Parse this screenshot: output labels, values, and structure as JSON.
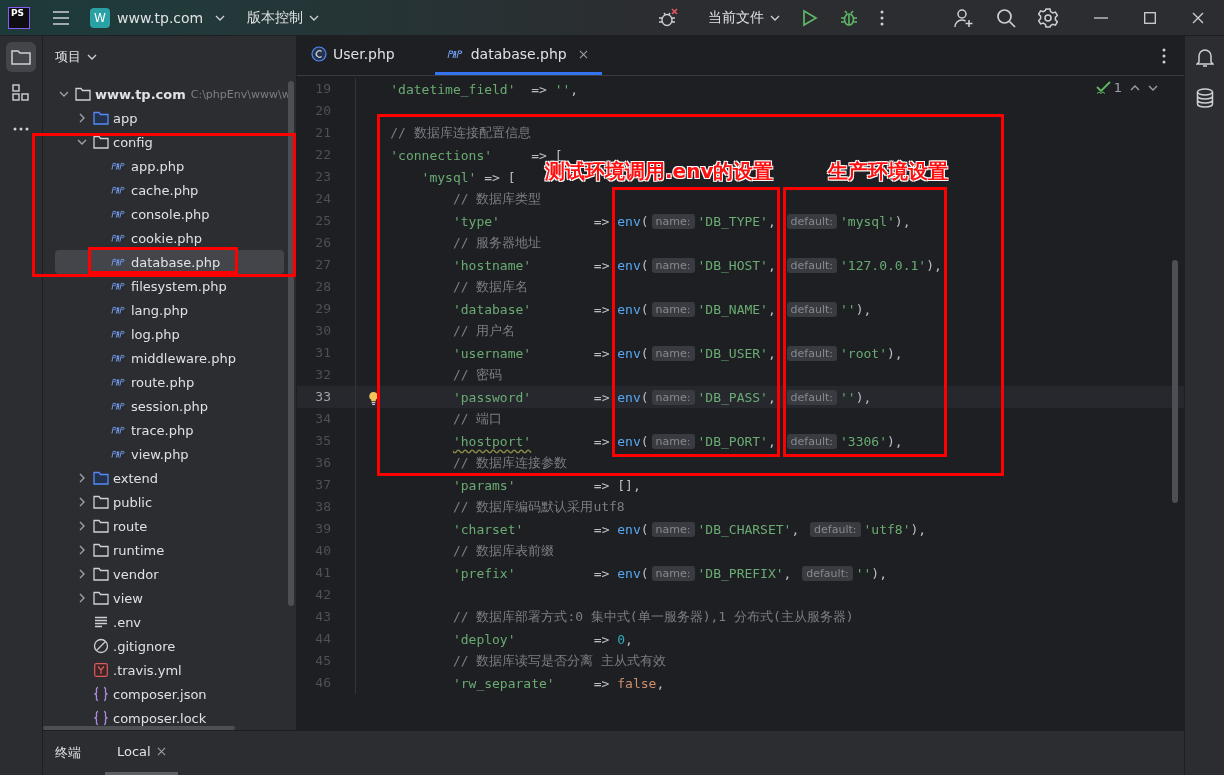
{
  "titlebar": {
    "logo": "PS",
    "project_badge": "W",
    "project": "www.tp.com",
    "vcs": "版本控制",
    "run_config": "当前文件"
  },
  "left_toolbar": [
    {
      "kind": "project",
      "selected": true
    },
    {
      "kind": "structure",
      "selected": false
    },
    {
      "kind": "more",
      "selected": false
    }
  ],
  "project_panel": {
    "title": "项目",
    "tree": [
      {
        "name": "www.tp.com",
        "path": "C:\\phpEnv\\www\\w",
        "kind": "folder",
        "expanded": true,
        "selected": false,
        "children": [
          {
            "name": "app",
            "kind": "source-folder",
            "expanded": false,
            "selected": false
          },
          {
            "name": "config",
            "kind": "folder",
            "expanded": true,
            "selected": false,
            "children": [
              {
                "name": "app.php",
                "kind": "php",
                "selected": false
              },
              {
                "name": "cache.php",
                "kind": "php",
                "selected": false
              },
              {
                "name": "console.php",
                "kind": "php",
                "selected": false
              },
              {
                "name": "cookie.php",
                "kind": "php",
                "selected": false
              },
              {
                "name": "database.php",
                "kind": "php",
                "selected": true
              },
              {
                "name": "filesystem.php",
                "kind": "php",
                "selected": false
              },
              {
                "name": "lang.php",
                "kind": "php",
                "selected": false
              },
              {
                "name": "log.php",
                "kind": "php",
                "selected": false
              },
              {
                "name": "middleware.php",
                "kind": "php",
                "selected": false
              },
              {
                "name": "route.php",
                "kind": "php",
                "selected": false
              },
              {
                "name": "session.php",
                "kind": "php",
                "selected": false
              },
              {
                "name": "trace.php",
                "kind": "php",
                "selected": false
              },
              {
                "name": "view.php",
                "kind": "php",
                "selected": false
              }
            ]
          },
          {
            "name": "extend",
            "kind": "source-folder",
            "expanded": false,
            "selected": false
          },
          {
            "name": "public",
            "kind": "folder",
            "expanded": false,
            "selected": false
          },
          {
            "name": "route",
            "kind": "folder",
            "expanded": false,
            "selected": false
          },
          {
            "name": "runtime",
            "kind": "folder",
            "expanded": false,
            "selected": false
          },
          {
            "name": "vendor",
            "kind": "folder",
            "expanded": false,
            "selected": false
          },
          {
            "name": "view",
            "kind": "folder",
            "expanded": false,
            "selected": false
          },
          {
            "name": ".env",
            "kind": "text",
            "selected": false
          },
          {
            "name": ".gitignore",
            "kind": "ignore",
            "selected": false
          },
          {
            "name": ".travis.yml",
            "kind": "yml",
            "selected": false
          },
          {
            "name": "composer.json",
            "kind": "json",
            "selected": false
          },
          {
            "name": "composer.lock",
            "kind": "json",
            "selected": false
          }
        ]
      }
    ]
  },
  "editor": {
    "tabs": [
      {
        "label": "User.php",
        "kind": "class",
        "selected": false,
        "closable": false
      },
      {
        "label": "database.php",
        "kind": "php",
        "selected": true,
        "closable": true
      }
    ],
    "inspection": {
      "count": "1"
    },
    "lines": [
      {
        "no": "19",
        "current": false,
        "tokens": [
          {
            "kind": "str",
            "text": "'datetime_field'"
          },
          {
            "kind": "txt",
            "text": "  => "
          },
          {
            "kind": "str",
            "text": "''"
          },
          {
            "kind": "txt",
            "text": ","
          }
        ]
      },
      {
        "no": "20",
        "current": false
      },
      {
        "no": "21",
        "current": false,
        "tokens": [
          {
            "kind": "cmt",
            "text": "// 数据库连接配置信息"
          }
        ]
      },
      {
        "no": "22",
        "current": false,
        "tokens": [
          {
            "kind": "str",
            "text": "'connections'"
          },
          {
            "kind": "txt",
            "text": "     => ["
          }
        ],
        "children": [
          {
            "no": "23",
            "current": false,
            "tokens": [
              {
                "kind": "str",
                "text": "'mysql'"
              },
              {
                "kind": "txt",
                "text": " => ["
              }
            ],
            "children": [
              {
                "no": "24",
                "current": false,
                "tokens": [
                  {
                    "kind": "cmt",
                    "text": "// 数据库类型"
                  }
                ]
              },
              {
                "no": "25",
                "current": false,
                "tokens": [
                  {
                    "kind": "str",
                    "text": "'type'"
                  },
                  {
                    "kind": "txt",
                    "text": "            => "
                  },
                  {
                    "kind": "fn",
                    "text": "env"
                  },
                  {
                    "kind": "txt",
                    "text": "("
                  },
                  {
                    "kind": "hint",
                    "text": "name:"
                  },
                  {
                    "kind": "str",
                    "text": "'DB_TYPE'"
                  },
                  {
                    "kind": "txt",
                    "text": ", "
                  },
                  {
                    "kind": "hint",
                    "text": "default:"
                  },
                  {
                    "kind": "str",
                    "text": "'mysql'"
                  },
                  {
                    "kind": "txt",
                    "text": "),"
                  }
                ]
              },
              {
                "no": "26",
                "current": false,
                "tokens": [
                  {
                    "kind": "cmt",
                    "text": "// 服务器地址"
                  }
                ]
              },
              {
                "no": "27",
                "current": false,
                "tokens": [
                  {
                    "kind": "str",
                    "text": "'hostname'"
                  },
                  {
                    "kind": "txt",
                    "text": "        => "
                  },
                  {
                    "kind": "fn",
                    "text": "env"
                  },
                  {
                    "kind": "txt",
                    "text": "("
                  },
                  {
                    "kind": "hint",
                    "text": "name:"
                  },
                  {
                    "kind": "str",
                    "text": "'DB_HOST'"
                  },
                  {
                    "kind": "txt",
                    "text": ", "
                  },
                  {
                    "kind": "hint",
                    "text": "default:"
                  },
                  {
                    "kind": "str",
                    "text": "'127.0.0.1'"
                  },
                  {
                    "kind": "txt",
                    "text": "),"
                  }
                ]
              },
              {
                "no": "28",
                "current": false,
                "tokens": [
                  {
                    "kind": "cmt",
                    "text": "// 数据库名"
                  }
                ]
              },
              {
                "no": "29",
                "current": false,
                "tokens": [
                  {
                    "kind": "str",
                    "text": "'database'"
                  },
                  {
                    "kind": "txt",
                    "text": "        => "
                  },
                  {
                    "kind": "fn",
                    "text": "env"
                  },
                  {
                    "kind": "txt",
                    "text": "("
                  },
                  {
                    "kind": "hint",
                    "text": "name:"
                  },
                  {
                    "kind": "str",
                    "text": "'DB_NAME'"
                  },
                  {
                    "kind": "txt",
                    "text": ", "
                  },
                  {
                    "kind": "hint",
                    "text": "default:"
                  },
                  {
                    "kind": "str",
                    "text": "''"
                  },
                  {
                    "kind": "txt",
                    "text": "),"
                  }
                ]
              },
              {
                "no": "30",
                "current": false,
                "tokens": [
                  {
                    "kind": "cmt",
                    "text": "// 用户名"
                  }
                ]
              },
              {
                "no": "31",
                "current": false,
                "tokens": [
                  {
                    "kind": "str",
                    "text": "'username'"
                  },
                  {
                    "kind": "txt",
                    "text": "        => "
                  },
                  {
                    "kind": "fn",
                    "text": "env"
                  },
                  {
                    "kind": "txt",
                    "text": "("
                  },
                  {
                    "kind": "hint",
                    "text": "name:"
                  },
                  {
                    "kind": "str",
                    "text": "'DB_USER'"
                  },
                  {
                    "kind": "txt",
                    "text": ", "
                  },
                  {
                    "kind": "hint",
                    "text": "default:"
                  },
                  {
                    "kind": "str",
                    "text": "'root'"
                  },
                  {
                    "kind": "txt",
                    "text": "),"
                  }
                ]
              },
              {
                "no": "32",
                "current": false,
                "tokens": [
                  {
                    "kind": "cmt",
                    "text": "// 密码"
                  }
                ]
              },
              {
                "no": "33",
                "current": true,
                "tokens": [
                  {
                    "kind": "str",
                    "text": "'password'"
                  },
                  {
                    "kind": "txt",
                    "text": "        => "
                  },
                  {
                    "kind": "fn",
                    "text": "env"
                  },
                  {
                    "kind": "txt",
                    "text": "("
                  },
                  {
                    "kind": "hint",
                    "text": "name:"
                  },
                  {
                    "kind": "str",
                    "text": "'DB_PASS'"
                  },
                  {
                    "kind": "txt",
                    "text": ", "
                  },
                  {
                    "kind": "hint",
                    "text": "default:"
                  },
                  {
                    "kind": "str",
                    "text": "''"
                  },
                  {
                    "kind": "txt",
                    "text": "),"
                  }
                ]
              },
              {
                "no": "34",
                "current": false,
                "tokens": [
                  {
                    "kind": "cmt",
                    "text": "// 端口"
                  }
                ]
              },
              {
                "no": "35",
                "current": false,
                "tokens": [
                  {
                    "kind": "typo",
                    "text": "'hostport'"
                  },
                  {
                    "kind": "txt",
                    "text": "        => "
                  },
                  {
                    "kind": "fn",
                    "text": "env"
                  },
                  {
                    "kind": "txt",
                    "text": "("
                  },
                  {
                    "kind": "hint",
                    "text": "name:"
                  },
                  {
                    "kind": "str",
                    "text": "'DB_PORT'"
                  },
                  {
                    "kind": "txt",
                    "text": ", "
                  },
                  {
                    "kind": "hint",
                    "text": "default:"
                  },
                  {
                    "kind": "str",
                    "text": "'3306'"
                  },
                  {
                    "kind": "txt",
                    "text": "),"
                  }
                ]
              },
              {
                "no": "36",
                "current": false,
                "tokens": [
                  {
                    "kind": "cmt",
                    "text": "// 数据库连接参数"
                  }
                ]
              },
              {
                "no": "37",
                "current": false,
                "tokens": [
                  {
                    "kind": "str",
                    "text": "'params'"
                  },
                  {
                    "kind": "txt",
                    "text": "          => [],"
                  }
                ]
              },
              {
                "no": "38",
                "current": false,
                "tokens": [
                  {
                    "kind": "cmt",
                    "text": "// 数据库编码默认采用utf8"
                  }
                ]
              },
              {
                "no": "39",
                "current": false,
                "tokens": [
                  {
                    "kind": "str",
                    "text": "'charset'"
                  },
                  {
                    "kind": "txt",
                    "text": "         => "
                  },
                  {
                    "kind": "fn",
                    "text": "env"
                  },
                  {
                    "kind": "txt",
                    "text": "("
                  },
                  {
                    "kind": "hint",
                    "text": "name:"
                  },
                  {
                    "kind": "str",
                    "text": "'DB_CHARSET'"
                  },
                  {
                    "kind": "txt",
                    "text": ", "
                  },
                  {
                    "kind": "hint",
                    "text": "default:"
                  },
                  {
                    "kind": "str",
                    "text": "'utf8'"
                  },
                  {
                    "kind": "txt",
                    "text": "),"
                  }
                ]
              },
              {
                "no": "40",
                "current": false,
                "tokens": [
                  {
                    "kind": "cmt",
                    "text": "// 数据库表前缀"
                  }
                ]
              },
              {
                "no": "41",
                "current": false,
                "tokens": [
                  {
                    "kind": "str",
                    "text": "'prefix'"
                  },
                  {
                    "kind": "txt",
                    "text": "          => "
                  },
                  {
                    "kind": "fn",
                    "text": "env"
                  },
                  {
                    "kind": "txt",
                    "text": "("
                  },
                  {
                    "kind": "hint",
                    "text": "name:"
                  },
                  {
                    "kind": "str",
                    "text": "'DB_PREFIX'"
                  },
                  {
                    "kind": "txt",
                    "text": ", "
                  },
                  {
                    "kind": "hint",
                    "text": "default:"
                  },
                  {
                    "kind": "str",
                    "text": "''"
                  },
                  {
                    "kind": "txt",
                    "text": "),"
                  }
                ]
              },
              {
                "no": "42",
                "current": false
              },
              {
                "no": "43",
                "current": false,
                "tokens": [
                  {
                    "kind": "cmt",
                    "text": "// 数据库部署方式:0 集中式(单一服务器),1 分布式(主从服务器)"
                  }
                ]
              },
              {
                "no": "44",
                "current": false,
                "tokens": [
                  {
                    "kind": "str",
                    "text": "'deploy'"
                  },
                  {
                    "kind": "txt",
                    "text": "          => "
                  },
                  {
                    "kind": "num",
                    "text": "0"
                  },
                  {
                    "kind": "txt",
                    "text": ","
                  }
                ]
              },
              {
                "no": "45",
                "current": false,
                "tokens": [
                  {
                    "kind": "cmt",
                    "text": "// 数据库读写是否分离 主从式有效"
                  }
                ]
              },
              {
                "no": "46",
                "current": false,
                "tokens": [
                  {
                    "kind": "str",
                    "text": "'rw_separate'"
                  },
                  {
                    "kind": "txt",
                    "text": "     => "
                  },
                  {
                    "kind": "kw",
                    "text": "false"
                  },
                  {
                    "kind": "txt",
                    "text": ","
                  }
                ]
              }
            ]
          }
        ]
      }
    ]
  },
  "annotations": {
    "labels": [
      "测试环境调用.env的设置",
      "生产环境设置"
    ]
  },
  "terminal": {
    "title": "终端",
    "tabs": [
      {
        "label": "Local",
        "selected": true
      }
    ]
  }
}
